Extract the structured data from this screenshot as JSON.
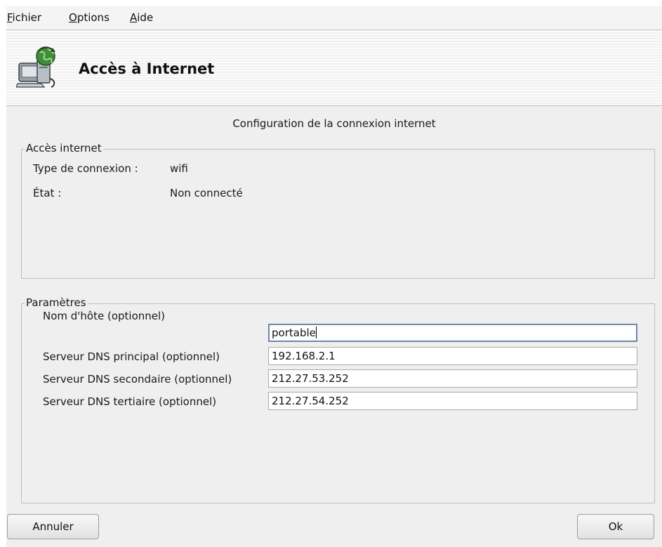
{
  "menubar": {
    "items": [
      {
        "first": "F",
        "rest": "ichier"
      },
      {
        "first": "O",
        "rest": "ptions"
      },
      {
        "first": "A",
        "rest": "ide"
      }
    ]
  },
  "header": {
    "title": "Accès à Internet",
    "icon": "network-computer-globe-icon"
  },
  "subtitle": "Configuration de la connexion internet",
  "access_group": {
    "label": "Accès internet",
    "rows": [
      {
        "label": "Type de connexion :",
        "value": "wifi"
      },
      {
        "label": "État :",
        "value": "Non connecté"
      }
    ]
  },
  "params_group": {
    "label": "Paramètres",
    "fields": [
      {
        "label": "Nom d'hôte (optionnel)",
        "value": "portable"
      },
      {
        "label": "Serveur DNS principal (optionnel)",
        "value": "192.168.2.1"
      },
      {
        "label": "Serveur DNS secondaire (optionnel)",
        "value": "212.27.53.252"
      },
      {
        "label": "Serveur DNS tertiaire (optionnel)",
        "value": "212.27.54.252"
      }
    ]
  },
  "buttons": {
    "cancel": "Annuler",
    "ok": "Ok"
  }
}
